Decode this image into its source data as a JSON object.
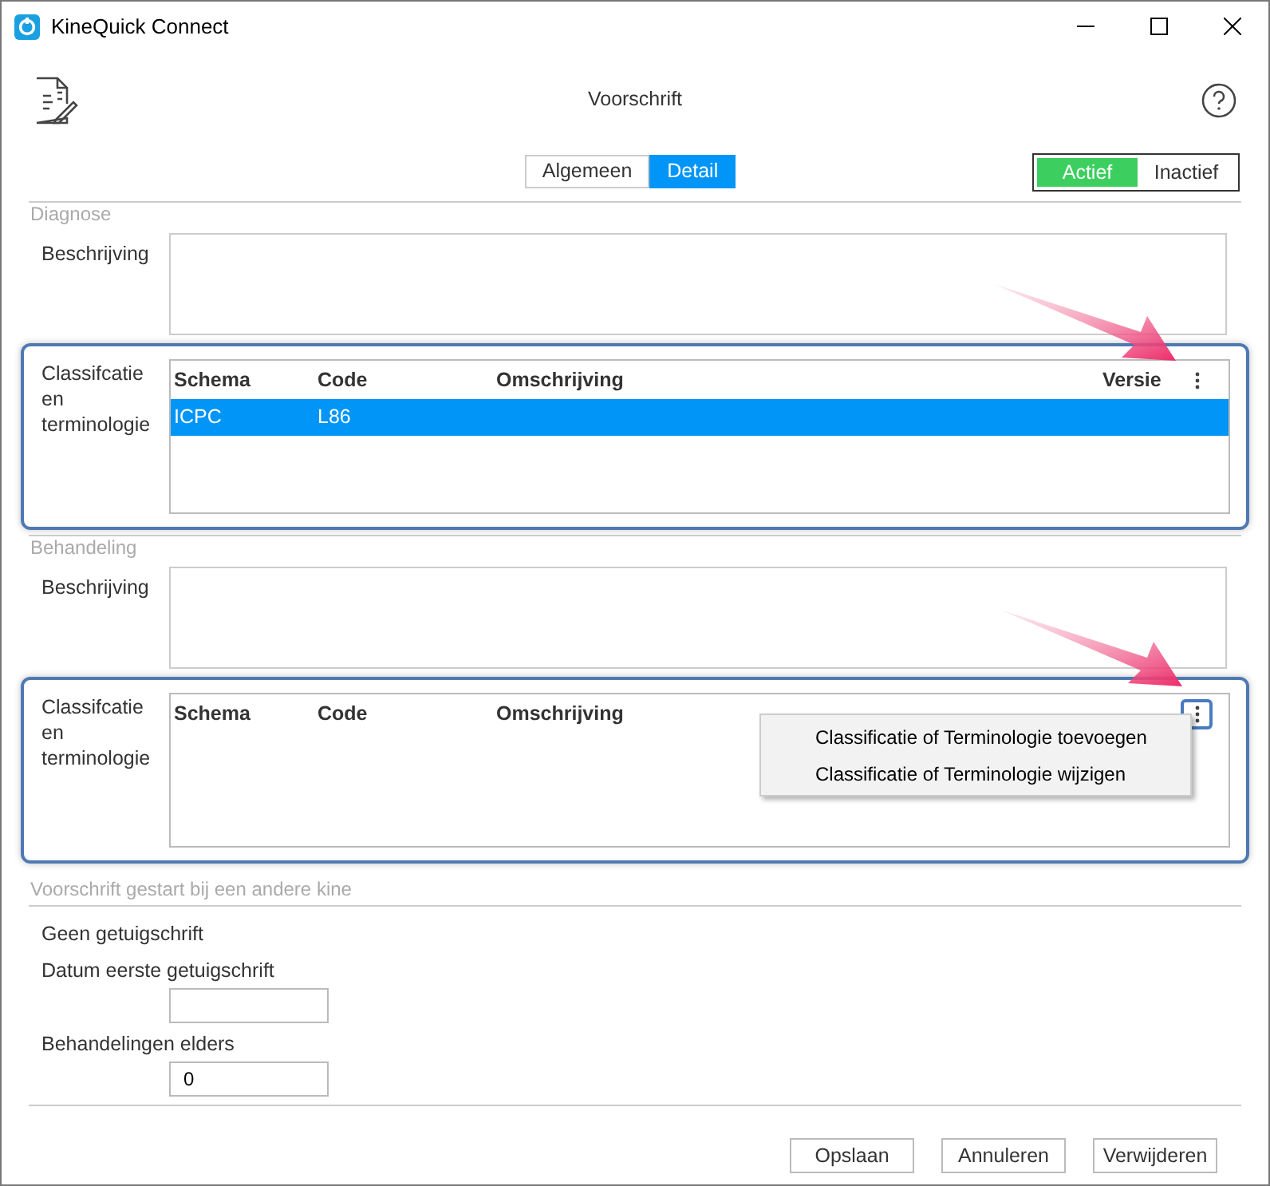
{
  "window": {
    "title": "KineQuick Connect"
  },
  "header": {
    "title": "Voorschrift"
  },
  "tabs": [
    {
      "label": "Algemeen",
      "selected": false
    },
    {
      "label": "Detail",
      "selected": true
    }
  ],
  "status_toggle": [
    {
      "label": "Actief",
      "selected": true
    },
    {
      "label": "Inactief",
      "selected": false
    }
  ],
  "sections": [
    {
      "title": "Diagnose",
      "description_label": "Beschrijving",
      "classification": {
        "label": "Classifcatie en terminologie",
        "highlighted": true,
        "columns": [
          "Schema",
          "Code",
          "Omschrijving",
          "Versie"
        ],
        "rows": [
          {
            "cells": [
              "ICPC",
              "L86"
            ],
            "selected": true
          }
        ],
        "menu_open": false
      }
    },
    {
      "title": "Behandeling",
      "description_label": "Beschrijving",
      "classification": {
        "label": "Classifcatie en terminologie",
        "highlighted": true,
        "columns": [
          "Schema",
          "Code",
          "Omschrijving"
        ],
        "menu_open": true,
        "menu_items": [
          "Classificatie of Terminologie toevoegen",
          "Classificatie of Terminologie wijzigen"
        ]
      }
    }
  ],
  "other_kine": {
    "title": "Voorschrift gestart bij een andere kine",
    "no_certificate_label": "Geen getuigschrift",
    "first_date_label": "Datum eerste getuigschrift",
    "treatments_label": "Behandelingen elders",
    "treatments_value": "0"
  },
  "buttons": [
    "Opslaan",
    "Annuleren",
    "Verwijderen"
  ]
}
